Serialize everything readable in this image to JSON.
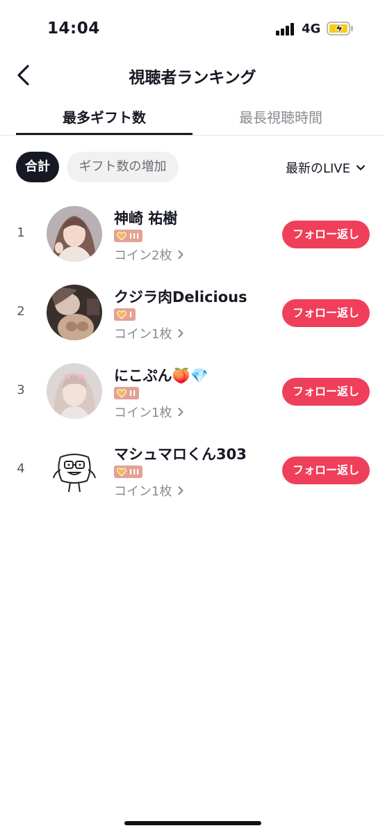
{
  "status_bar": {
    "time": "14:04",
    "network": "4G"
  },
  "header": {
    "title": "視聴者ランキング"
  },
  "tabs": [
    {
      "label": "最多ギフト数",
      "active": true
    },
    {
      "label": "最長視聴時間",
      "active": false
    }
  ],
  "filters": {
    "total_label": "合計",
    "gift_increase_label": "ギフト数の増加",
    "live_selector": "最新のLIVE"
  },
  "rows": [
    {
      "rank": "1",
      "name": "神崎 祐樹",
      "badge_level": "III",
      "coins": "コイン2枚",
      "follow_label": "フォロー返し"
    },
    {
      "rank": "2",
      "name": "クジラ肉Delicious",
      "badge_level": "I",
      "coins": "コイン1枚",
      "follow_label": "フォロー返し"
    },
    {
      "rank": "3",
      "name": "にこぷん🍑💎",
      "badge_level": "II",
      "coins": "コイン1枚",
      "follow_label": "フォロー返し"
    },
    {
      "rank": "4",
      "name": "マシュマロくん303",
      "badge_level": "III",
      "coins": "コイン1枚",
      "follow_label": "フォロー返し"
    }
  ],
  "colors": {
    "accent_follow": "#ef3f5a",
    "badge_bg": "#e2a294",
    "battery": "#f5cc1c"
  }
}
